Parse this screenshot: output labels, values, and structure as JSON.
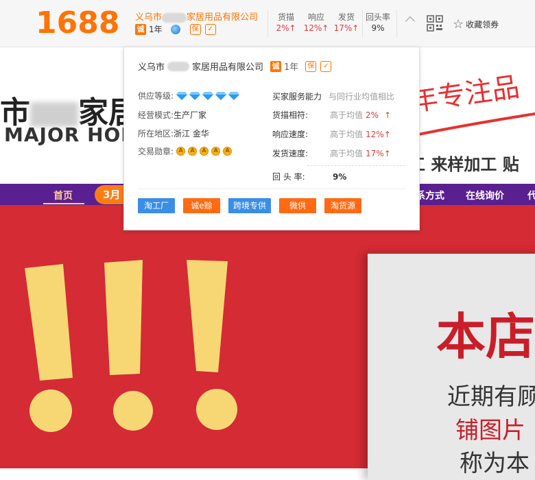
{
  "logo": "1688",
  "header": {
    "shop_name_prefix": "义乌市",
    "shop_name_suffix": "家居用品有限公司",
    "cheng_badge": "诚",
    "years": "1年",
    "metrics": [
      {
        "label": "货描",
        "value": "2%↑"
      },
      {
        "label": "响应",
        "value": "12%↑"
      },
      {
        "label": "发货",
        "value": "17%↑"
      }
    ],
    "repeat_label": "回头率",
    "repeat_value": "9%",
    "favorite": "收藏领券"
  },
  "popup": {
    "shop_name_prefix": "义乌市",
    "shop_name_suffix": "家居用品有限公司",
    "cheng_badge": "诚",
    "years": "1年",
    "supplier_level_label": "供应等级:",
    "supplier_level_count": 5,
    "mode_label": "经营模式:",
    "mode_value": "生产厂家",
    "region_label": "所在地区:",
    "region_value": "浙江 金华",
    "medal_label": "交易勋章:",
    "medal_count": 5,
    "service_title": "买家服务能力",
    "service_compare": "与同行业均值相比",
    "service_rows": [
      {
        "label": "货描相符:",
        "compare": "高于均值",
        "value": "2%",
        "arrow": "↑"
      },
      {
        "label": "响应速度:",
        "compare": "高于均值",
        "value": "12%",
        "arrow": "↑"
      },
      {
        "label": "发货速度:",
        "compare": "高于均值",
        "value": "17%",
        "arrow": "↑"
      }
    ],
    "repeat_label": "回 头 率:",
    "repeat_value": "9%",
    "tags": [
      "淘工厂",
      "诚e赊",
      "跨境专供",
      "微供",
      "淘货源"
    ],
    "tag_colors": [
      "#3a8ee6",
      "#ff6a13",
      "#3a8ee6",
      "#ff6a13",
      "#ff6a13"
    ]
  },
  "hero": {
    "title_prefix": "市",
    "title_suffix": "家居",
    "english": "MAJOR HOM",
    "slogan": "年专注品",
    "process": "工 来样加工 贴"
  },
  "nav": {
    "home": "首页",
    "pill": "3月",
    "contact": "系方式",
    "inquiry": "在线询价",
    "more": "代"
  },
  "notice": {
    "title": "本店",
    "line1": "近期有顾",
    "line2": "铺图片",
    "line3": "称为本"
  },
  "colors": {
    "accent": "#ff7300",
    "nav": "#5a1f91",
    "banner_red": "#d42b34",
    "up_red": "#e4393c"
  }
}
